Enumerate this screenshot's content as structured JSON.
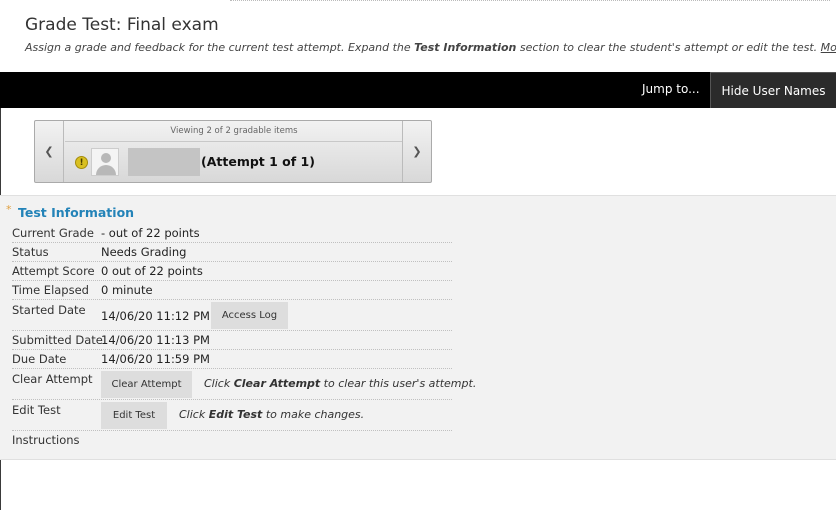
{
  "header": {
    "title": "Grade Test: Final exam",
    "subtitle_pre": "Assign a grade and feedback for the current test attempt. Expand the ",
    "subtitle_bold": "Test Information",
    "subtitle_post": " section to clear the student's attempt or edit the test. ",
    "help_link": "More Help"
  },
  "actionbar": {
    "jump_label": "Jump to...",
    "hide_names_label": "Hide User Names"
  },
  "pager": {
    "viewing_text": "Viewing 2 of 2 gradable items",
    "status_icon": "!",
    "attempt_text": "(Attempt 1 of 1)"
  },
  "test_info": {
    "title": "Test Information",
    "expand_marker": "*",
    "current_grade_label": "Current Grade",
    "current_grade_value": "- out of 22 points",
    "status_label": "Status",
    "status_value": "Needs Grading",
    "attempt_score_label": "Attempt Score",
    "attempt_score_value": "0 out of 22 points",
    "time_elapsed_label": "Time Elapsed",
    "time_elapsed_value": "0 minute",
    "started_date_label": "Started Date",
    "started_date_value": "14/06/20 11:12 PM",
    "access_log_label": "Access Log",
    "submitted_date_label": "Submitted Date",
    "submitted_date_value": "14/06/20 11:13 PM",
    "due_date_label": "Due Date",
    "due_date_value": "14/06/20 11:59 PM",
    "clear_attempt_label": "Clear Attempt",
    "clear_attempt_button": "Clear Attempt",
    "clear_hint_pre": "Click ",
    "clear_hint_bold": "Clear Attempt",
    "clear_hint_post": " to clear this user's attempt.",
    "edit_test_label": "Edit Test",
    "edit_test_button": "Edit Test",
    "edit_hint_pre": "Click ",
    "edit_hint_bold": "Edit Test",
    "edit_hint_post": " to make changes.",
    "instructions_label": "Instructions"
  },
  "colors": {
    "accent": "#2383b8",
    "action_bar": "#000000",
    "panel_bg": "#f2f2f2"
  }
}
